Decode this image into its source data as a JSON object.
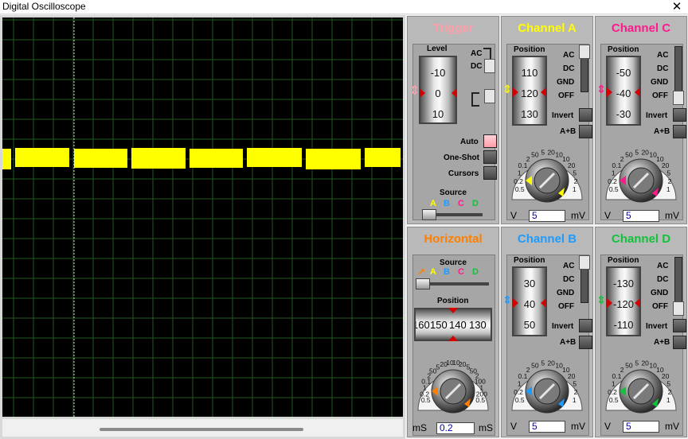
{
  "window": {
    "title": "Digital Oscilloscope",
    "close": "✕"
  },
  "colors": {
    "trace": "#ffff00",
    "grid": "#1f5a1f",
    "trigger": "#ff9ea8",
    "chA": "#ffff00",
    "chB": "#1e9bff",
    "chC": "#ff1a8c",
    "chD": "#12c23c",
    "horizontal": "#ff7f00"
  },
  "trigger": {
    "title": "Trigger",
    "level_label": "Level",
    "level_values": [
      "-10",
      "0",
      "10"
    ],
    "ac": "AC",
    "dc": "DC",
    "auto": "Auto",
    "oneshot": "One-Shot",
    "cursors": "Cursors",
    "source_label": "Source",
    "sources": [
      "A",
      "B",
      "C",
      "D"
    ]
  },
  "horizontal": {
    "title": "Horizontal",
    "source_label": "Source",
    "sources": [
      "A",
      "B",
      "C",
      "D"
    ],
    "position_label": "Position",
    "position_values": [
      "160",
      "150",
      "140",
      "130"
    ],
    "knob_ticks": [
      "0.5",
      "0.2",
      "1",
      "0.1",
      "2",
      "50",
      "5",
      "20",
      "10",
      "10",
      "20",
      "5",
      "50",
      "2",
      "100",
      "1",
      "200",
      "0.5"
    ],
    "unit_left": "mS",
    "unit_right": "mS",
    "readout": "0.2"
  },
  "channels": [
    {
      "key": "A",
      "title": "Channel A",
      "position_label": "Position",
      "drum": [
        "110",
        "120",
        "130"
      ],
      "ac": "AC",
      "dc": "DC",
      "gnd": "GND",
      "off": "OFF",
      "invert": "Invert",
      "aplusb": "A+B",
      "ticks": [
        "0.5",
        "0.2",
        "1",
        "0.1",
        "2",
        "50",
        "5",
        "20",
        "10",
        "10",
        "20",
        "5",
        "2",
        "1"
      ],
      "unit_left": "V",
      "unit_right": "mV",
      "readout": "5"
    },
    {
      "key": "C",
      "title": "Channel C",
      "position_label": "Position",
      "drum": [
        "-50",
        "-40",
        "-30"
      ],
      "ac": "AC",
      "dc": "DC",
      "gnd": "GND",
      "off": "OFF",
      "invert": "Invert",
      "aplusb": "A+B",
      "ticks": [
        "0.5",
        "0.2",
        "1",
        "0.1",
        "2",
        "50",
        "5",
        "20",
        "10",
        "10",
        "20",
        "5",
        "2",
        "1"
      ],
      "unit_left": "V",
      "unit_right": "mV",
      "readout": "5"
    },
    {
      "key": "B",
      "title": "Channel B",
      "position_label": "Position",
      "drum": [
        "30",
        "40",
        "50"
      ],
      "ac": "AC",
      "dc": "DC",
      "gnd": "GND",
      "off": "OFF",
      "invert": "Invert",
      "aplusb": "A+B",
      "ticks": [
        "0.5",
        "0.2",
        "1",
        "0.1",
        "2",
        "50",
        "5",
        "20",
        "10",
        "10",
        "20",
        "5",
        "2",
        "1"
      ],
      "unit_left": "V",
      "unit_right": "mV",
      "readout": "5"
    },
    {
      "key": "D",
      "title": "Channel D",
      "position_label": "Position",
      "drum": [
        "-130",
        "-120",
        "-110"
      ],
      "ac": "AC",
      "dc": "DC",
      "gnd": "GND",
      "off": "OFF",
      "invert": "Invert",
      "aplusb": "A+B",
      "ticks": [
        "0.5",
        "0.2",
        "1",
        "0.1",
        "2",
        "50",
        "5",
        "20",
        "10",
        "10",
        "20",
        "5",
        "2",
        "1"
      ],
      "unit_left": "V",
      "unit_right": "mV",
      "readout": "5"
    }
  ]
}
